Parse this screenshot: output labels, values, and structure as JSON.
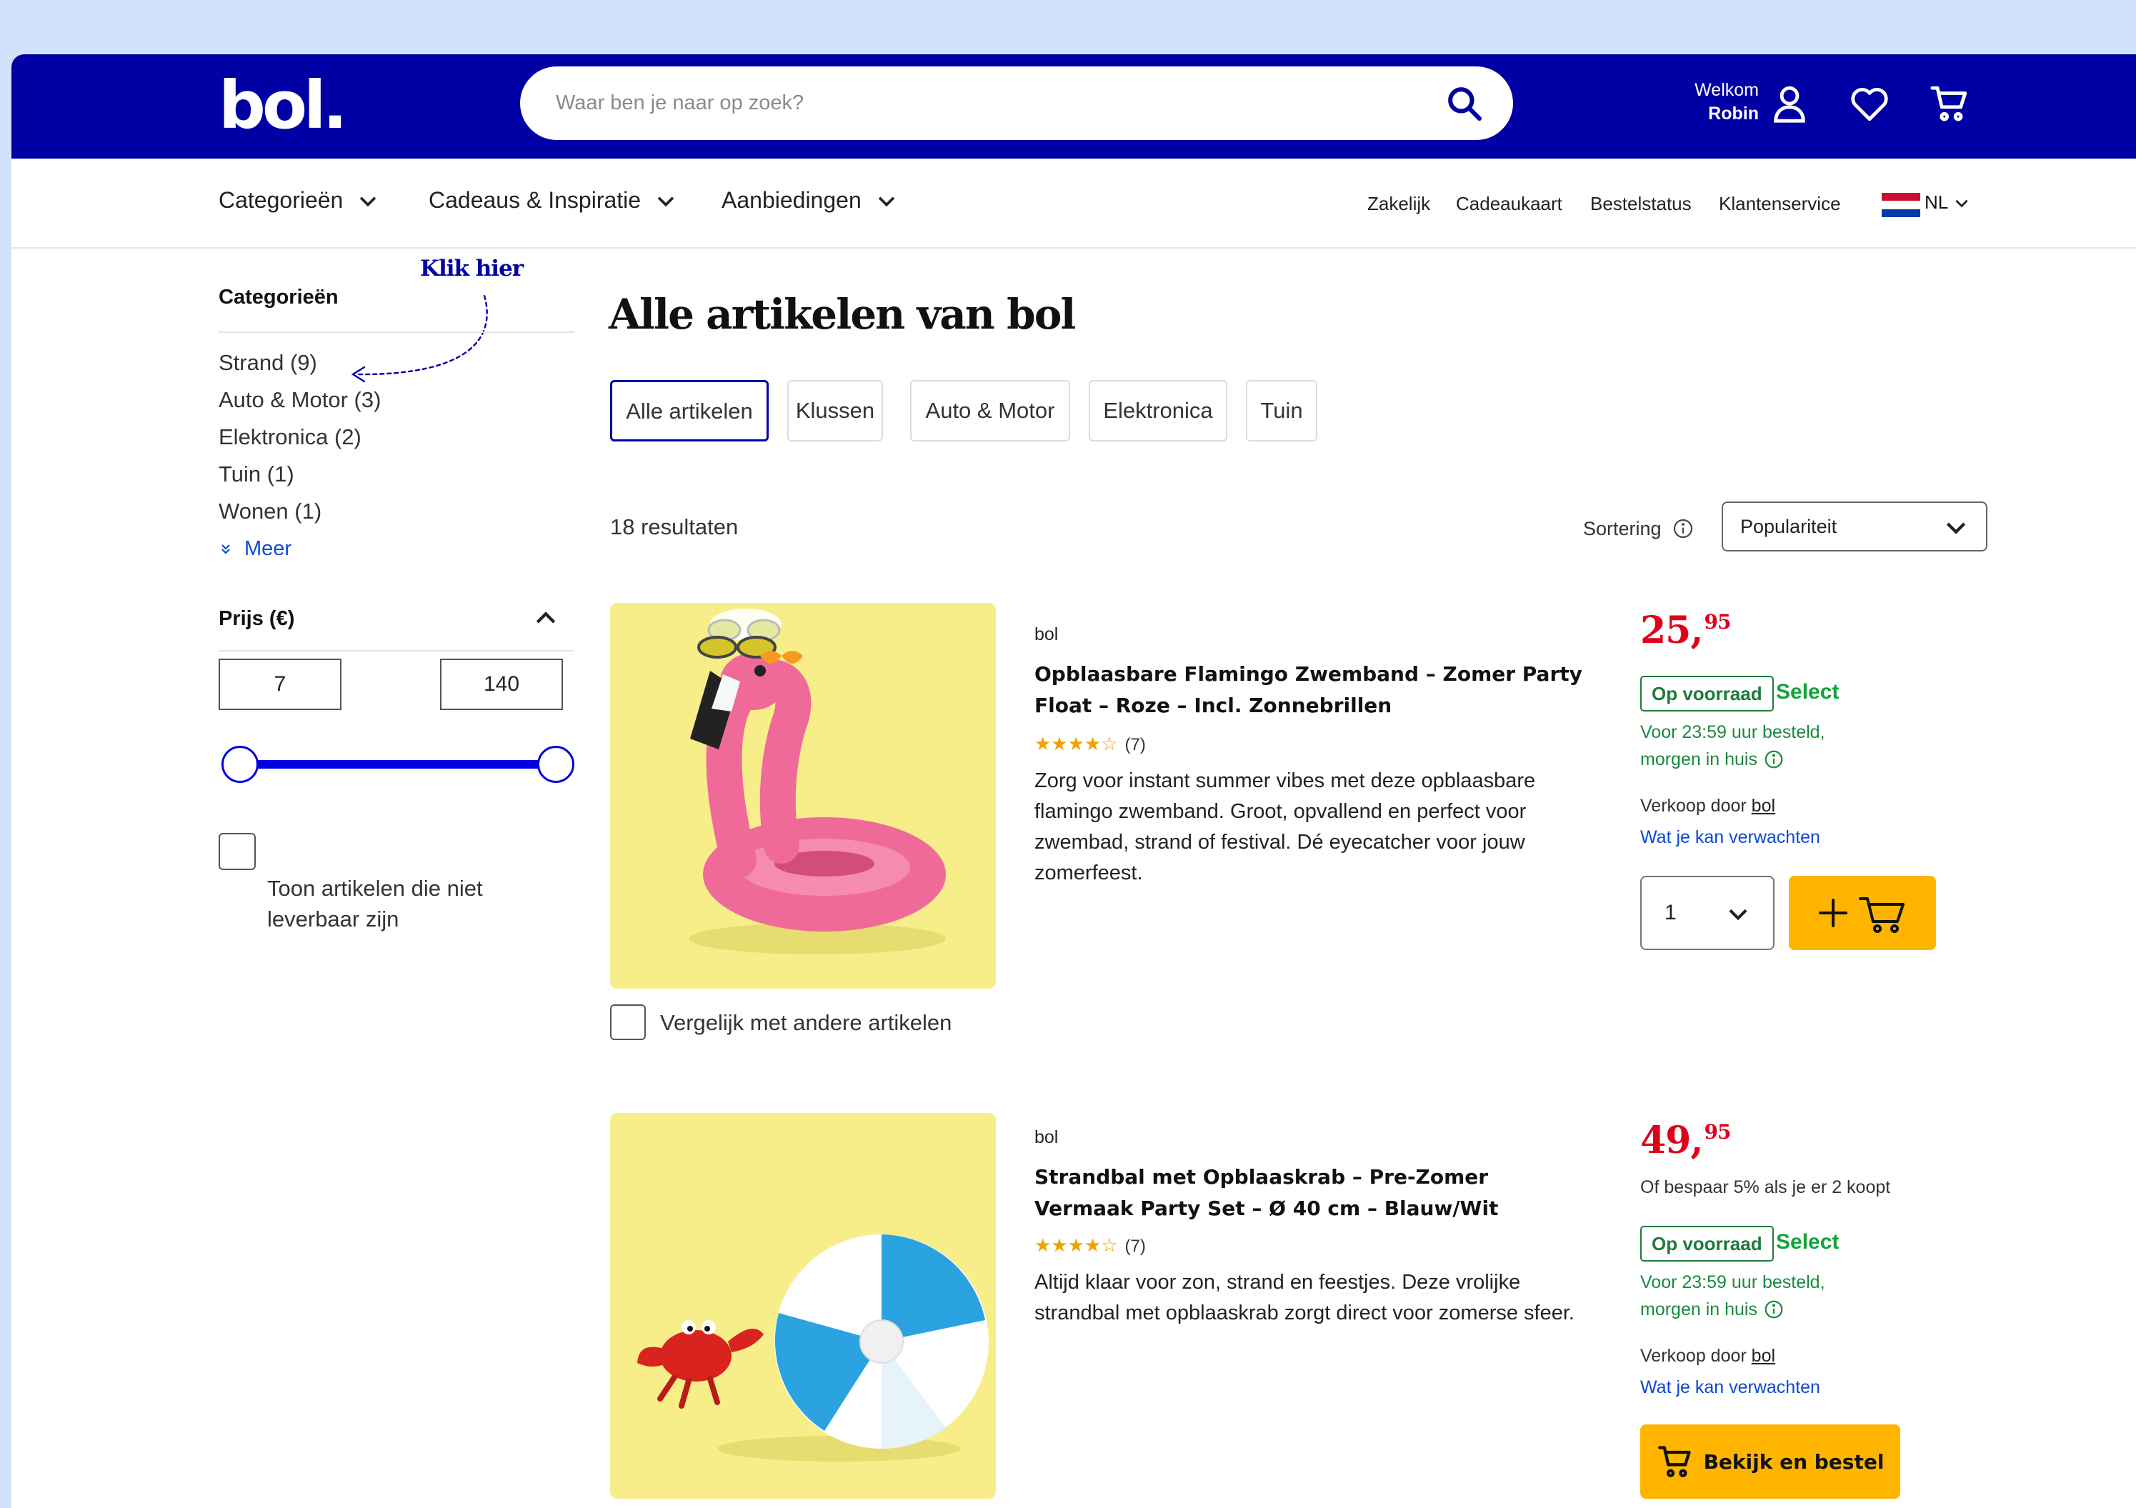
{
  "header": {
    "logo": "bol.",
    "search_placeholder": "Waar ben je naar op zoek?",
    "welcome_line1": "Welkom",
    "welcome_line2": "Robin"
  },
  "nav": {
    "left": [
      "Categorieën",
      "Cadeaus & Inspiratie",
      "Aanbiedingen"
    ],
    "right": [
      "Zakelijk",
      "Cadeaukaart",
      "Bestelstatus",
      "Klantenservice"
    ],
    "language": "NL"
  },
  "sidebar": {
    "title": "Categorieën",
    "annotation": "Klik hier",
    "categories": [
      "Strand (9)",
      "Auto & Motor (3)",
      "Elektronica (2)",
      "Tuin (1)",
      "Wonen (1)"
    ],
    "more": "Meer",
    "price_title": "Prijs (€)",
    "price_min": "7",
    "price_max": "140",
    "price_range_fraction": [
      0.0,
      1.0
    ],
    "unavailable_label": "Toon artikelen die niet leverbaar zijn"
  },
  "main": {
    "title": "Alle artikelen van bol",
    "tabs": [
      "Alle artikelen",
      "Klussen",
      "Auto & Motor",
      "Elektronica",
      "Tuin"
    ],
    "results": "18 resultaten",
    "sort_label": "Sortering",
    "sort_value": "Populariteit",
    "compare_label": "Vergelijk met andere artikelen"
  },
  "products": [
    {
      "seller": "bol",
      "title": "Opblaasbare Flamingo Zwemband – Zomer Party Float – Roze – Incl. Zonnebrillen",
      "stars": "★★★★☆",
      "rating_count": "(7)",
      "description": "Zorg voor instant summer vibes met deze opblaasbare flamingo zwemband. Groot, opvallend en perfect voor zwembad, strand of festival. Dé eyecatcher voor jouw zomerfeest.",
      "price_main": "25,",
      "price_cents": "95",
      "stock": "Op voorraad",
      "select": "Select",
      "delivery_line1": "Voor 23:59 uur besteld,",
      "delivery_line2": "morgen in huis",
      "sold_by_prefix": "Verkoop door",
      "sold_by": "bol",
      "expect": "Wat je kan verwachten",
      "quantity": "1"
    },
    {
      "seller": "bol",
      "title": "Strandbal met Opblaaskrab – Pre-Zomer Vermaak Party Set – Ø 40 cm – Blauw/Wit",
      "stars": "★★★★☆",
      "rating_count": "(7)",
      "description": "Altijd klaar voor zon, strand en feestjes. Deze vrolijke strandbal met opblaaskrab zorgt direct voor zomerse sfeer.",
      "price_main": "49,",
      "price_cents": "95",
      "save_text": "Of bespaar 5% als je er 2 koopt",
      "stock": "Op voorraad",
      "select": "Select",
      "delivery_line1": "Voor 23:59 uur besteld,",
      "delivery_line2": "morgen in huis",
      "sold_by_prefix": "Verkoop door",
      "sold_by": "bol",
      "expect": "Wat je kan verwachten",
      "button": "Bekijk en bestel"
    }
  ],
  "colors": {
    "brand": "#0000a4",
    "price": "#e0001b",
    "cta": "#ffb400",
    "stock": "#1f7a3a",
    "background": "#d3e2fb"
  }
}
